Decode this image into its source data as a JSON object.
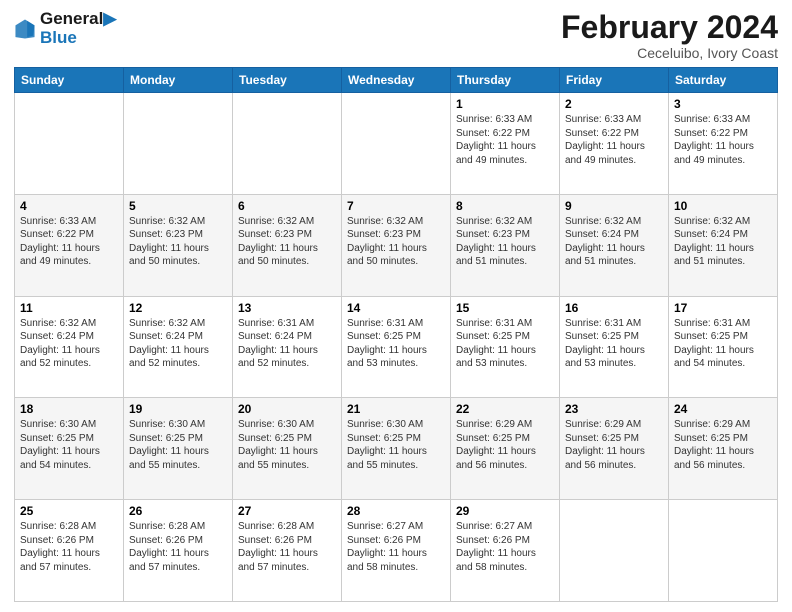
{
  "logo": {
    "line1": "General",
    "line2": "Blue"
  },
  "title": "February 2024",
  "subtitle": "Ceceluibo, Ivory Coast",
  "days_header": [
    "Sunday",
    "Monday",
    "Tuesday",
    "Wednesday",
    "Thursday",
    "Friday",
    "Saturday"
  ],
  "weeks": [
    [
      {
        "day": "",
        "info": ""
      },
      {
        "day": "",
        "info": ""
      },
      {
        "day": "",
        "info": ""
      },
      {
        "day": "",
        "info": ""
      },
      {
        "day": "1",
        "info": "Sunrise: 6:33 AM\nSunset: 6:22 PM\nDaylight: 11 hours\nand 49 minutes."
      },
      {
        "day": "2",
        "info": "Sunrise: 6:33 AM\nSunset: 6:22 PM\nDaylight: 11 hours\nand 49 minutes."
      },
      {
        "day": "3",
        "info": "Sunrise: 6:33 AM\nSunset: 6:22 PM\nDaylight: 11 hours\nand 49 minutes."
      }
    ],
    [
      {
        "day": "4",
        "info": "Sunrise: 6:33 AM\nSunset: 6:22 PM\nDaylight: 11 hours\nand 49 minutes."
      },
      {
        "day": "5",
        "info": "Sunrise: 6:32 AM\nSunset: 6:23 PM\nDaylight: 11 hours\nand 50 minutes."
      },
      {
        "day": "6",
        "info": "Sunrise: 6:32 AM\nSunset: 6:23 PM\nDaylight: 11 hours\nand 50 minutes."
      },
      {
        "day": "7",
        "info": "Sunrise: 6:32 AM\nSunset: 6:23 PM\nDaylight: 11 hours\nand 50 minutes."
      },
      {
        "day": "8",
        "info": "Sunrise: 6:32 AM\nSunset: 6:23 PM\nDaylight: 11 hours\nand 51 minutes."
      },
      {
        "day": "9",
        "info": "Sunrise: 6:32 AM\nSunset: 6:24 PM\nDaylight: 11 hours\nand 51 minutes."
      },
      {
        "day": "10",
        "info": "Sunrise: 6:32 AM\nSunset: 6:24 PM\nDaylight: 11 hours\nand 51 minutes."
      }
    ],
    [
      {
        "day": "11",
        "info": "Sunrise: 6:32 AM\nSunset: 6:24 PM\nDaylight: 11 hours\nand 52 minutes."
      },
      {
        "day": "12",
        "info": "Sunrise: 6:32 AM\nSunset: 6:24 PM\nDaylight: 11 hours\nand 52 minutes."
      },
      {
        "day": "13",
        "info": "Sunrise: 6:31 AM\nSunset: 6:24 PM\nDaylight: 11 hours\nand 52 minutes."
      },
      {
        "day": "14",
        "info": "Sunrise: 6:31 AM\nSunset: 6:25 PM\nDaylight: 11 hours\nand 53 minutes."
      },
      {
        "day": "15",
        "info": "Sunrise: 6:31 AM\nSunset: 6:25 PM\nDaylight: 11 hours\nand 53 minutes."
      },
      {
        "day": "16",
        "info": "Sunrise: 6:31 AM\nSunset: 6:25 PM\nDaylight: 11 hours\nand 53 minutes."
      },
      {
        "day": "17",
        "info": "Sunrise: 6:31 AM\nSunset: 6:25 PM\nDaylight: 11 hours\nand 54 minutes."
      }
    ],
    [
      {
        "day": "18",
        "info": "Sunrise: 6:30 AM\nSunset: 6:25 PM\nDaylight: 11 hours\nand 54 minutes."
      },
      {
        "day": "19",
        "info": "Sunrise: 6:30 AM\nSunset: 6:25 PM\nDaylight: 11 hours\nand 55 minutes."
      },
      {
        "day": "20",
        "info": "Sunrise: 6:30 AM\nSunset: 6:25 PM\nDaylight: 11 hours\nand 55 minutes."
      },
      {
        "day": "21",
        "info": "Sunrise: 6:30 AM\nSunset: 6:25 PM\nDaylight: 11 hours\nand 55 minutes."
      },
      {
        "day": "22",
        "info": "Sunrise: 6:29 AM\nSunset: 6:25 PM\nDaylight: 11 hours\nand 56 minutes."
      },
      {
        "day": "23",
        "info": "Sunrise: 6:29 AM\nSunset: 6:25 PM\nDaylight: 11 hours\nand 56 minutes."
      },
      {
        "day": "24",
        "info": "Sunrise: 6:29 AM\nSunset: 6:25 PM\nDaylight: 11 hours\nand 56 minutes."
      }
    ],
    [
      {
        "day": "25",
        "info": "Sunrise: 6:28 AM\nSunset: 6:26 PM\nDaylight: 11 hours\nand 57 minutes."
      },
      {
        "day": "26",
        "info": "Sunrise: 6:28 AM\nSunset: 6:26 PM\nDaylight: 11 hours\nand 57 minutes."
      },
      {
        "day": "27",
        "info": "Sunrise: 6:28 AM\nSunset: 6:26 PM\nDaylight: 11 hours\nand 57 minutes."
      },
      {
        "day": "28",
        "info": "Sunrise: 6:27 AM\nSunset: 6:26 PM\nDaylight: 11 hours\nand 58 minutes."
      },
      {
        "day": "29",
        "info": "Sunrise: 6:27 AM\nSunset: 6:26 PM\nDaylight: 11 hours\nand 58 minutes."
      },
      {
        "day": "",
        "info": ""
      },
      {
        "day": "",
        "info": ""
      }
    ]
  ]
}
